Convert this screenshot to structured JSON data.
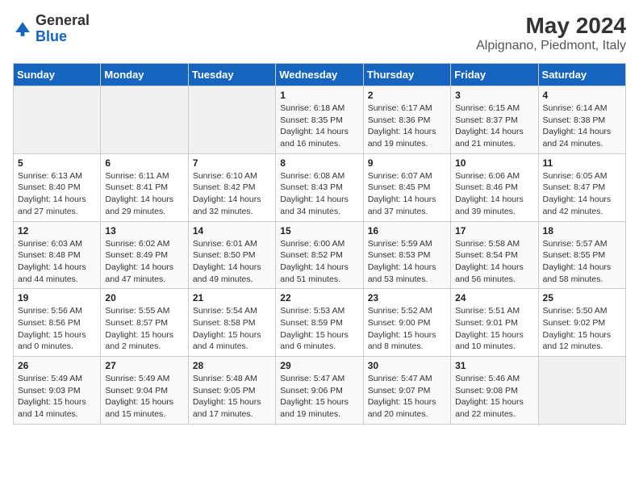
{
  "header": {
    "logo_general": "General",
    "logo_blue": "Blue",
    "month_title": "May 2024",
    "location": "Alpignano, Piedmont, Italy"
  },
  "calendar": {
    "days_of_week": [
      "Sunday",
      "Monday",
      "Tuesday",
      "Wednesday",
      "Thursday",
      "Friday",
      "Saturday"
    ],
    "weeks": [
      [
        {
          "day": "",
          "info": ""
        },
        {
          "day": "",
          "info": ""
        },
        {
          "day": "",
          "info": ""
        },
        {
          "day": "1",
          "info": "Sunrise: 6:18 AM\nSunset: 8:35 PM\nDaylight: 14 hours and 16 minutes."
        },
        {
          "day": "2",
          "info": "Sunrise: 6:17 AM\nSunset: 8:36 PM\nDaylight: 14 hours and 19 minutes."
        },
        {
          "day": "3",
          "info": "Sunrise: 6:15 AM\nSunset: 8:37 PM\nDaylight: 14 hours and 21 minutes."
        },
        {
          "day": "4",
          "info": "Sunrise: 6:14 AM\nSunset: 8:38 PM\nDaylight: 14 hours and 24 minutes."
        }
      ],
      [
        {
          "day": "5",
          "info": "Sunrise: 6:13 AM\nSunset: 8:40 PM\nDaylight: 14 hours and 27 minutes."
        },
        {
          "day": "6",
          "info": "Sunrise: 6:11 AM\nSunset: 8:41 PM\nDaylight: 14 hours and 29 minutes."
        },
        {
          "day": "7",
          "info": "Sunrise: 6:10 AM\nSunset: 8:42 PM\nDaylight: 14 hours and 32 minutes."
        },
        {
          "day": "8",
          "info": "Sunrise: 6:08 AM\nSunset: 8:43 PM\nDaylight: 14 hours and 34 minutes."
        },
        {
          "day": "9",
          "info": "Sunrise: 6:07 AM\nSunset: 8:45 PM\nDaylight: 14 hours and 37 minutes."
        },
        {
          "day": "10",
          "info": "Sunrise: 6:06 AM\nSunset: 8:46 PM\nDaylight: 14 hours and 39 minutes."
        },
        {
          "day": "11",
          "info": "Sunrise: 6:05 AM\nSunset: 8:47 PM\nDaylight: 14 hours and 42 minutes."
        }
      ],
      [
        {
          "day": "12",
          "info": "Sunrise: 6:03 AM\nSunset: 8:48 PM\nDaylight: 14 hours and 44 minutes."
        },
        {
          "day": "13",
          "info": "Sunrise: 6:02 AM\nSunset: 8:49 PM\nDaylight: 14 hours and 47 minutes."
        },
        {
          "day": "14",
          "info": "Sunrise: 6:01 AM\nSunset: 8:50 PM\nDaylight: 14 hours and 49 minutes."
        },
        {
          "day": "15",
          "info": "Sunrise: 6:00 AM\nSunset: 8:52 PM\nDaylight: 14 hours and 51 minutes."
        },
        {
          "day": "16",
          "info": "Sunrise: 5:59 AM\nSunset: 8:53 PM\nDaylight: 14 hours and 53 minutes."
        },
        {
          "day": "17",
          "info": "Sunrise: 5:58 AM\nSunset: 8:54 PM\nDaylight: 14 hours and 56 minutes."
        },
        {
          "day": "18",
          "info": "Sunrise: 5:57 AM\nSunset: 8:55 PM\nDaylight: 14 hours and 58 minutes."
        }
      ],
      [
        {
          "day": "19",
          "info": "Sunrise: 5:56 AM\nSunset: 8:56 PM\nDaylight: 15 hours and 0 minutes."
        },
        {
          "day": "20",
          "info": "Sunrise: 5:55 AM\nSunset: 8:57 PM\nDaylight: 15 hours and 2 minutes."
        },
        {
          "day": "21",
          "info": "Sunrise: 5:54 AM\nSunset: 8:58 PM\nDaylight: 15 hours and 4 minutes."
        },
        {
          "day": "22",
          "info": "Sunrise: 5:53 AM\nSunset: 8:59 PM\nDaylight: 15 hours and 6 minutes."
        },
        {
          "day": "23",
          "info": "Sunrise: 5:52 AM\nSunset: 9:00 PM\nDaylight: 15 hours and 8 minutes."
        },
        {
          "day": "24",
          "info": "Sunrise: 5:51 AM\nSunset: 9:01 PM\nDaylight: 15 hours and 10 minutes."
        },
        {
          "day": "25",
          "info": "Sunrise: 5:50 AM\nSunset: 9:02 PM\nDaylight: 15 hours and 12 minutes."
        }
      ],
      [
        {
          "day": "26",
          "info": "Sunrise: 5:49 AM\nSunset: 9:03 PM\nDaylight: 15 hours and 14 minutes."
        },
        {
          "day": "27",
          "info": "Sunrise: 5:49 AM\nSunset: 9:04 PM\nDaylight: 15 hours and 15 minutes."
        },
        {
          "day": "28",
          "info": "Sunrise: 5:48 AM\nSunset: 9:05 PM\nDaylight: 15 hours and 17 minutes."
        },
        {
          "day": "29",
          "info": "Sunrise: 5:47 AM\nSunset: 9:06 PM\nDaylight: 15 hours and 19 minutes."
        },
        {
          "day": "30",
          "info": "Sunrise: 5:47 AM\nSunset: 9:07 PM\nDaylight: 15 hours and 20 minutes."
        },
        {
          "day": "31",
          "info": "Sunrise: 5:46 AM\nSunset: 9:08 PM\nDaylight: 15 hours and 22 minutes."
        },
        {
          "day": "",
          "info": ""
        }
      ]
    ]
  }
}
